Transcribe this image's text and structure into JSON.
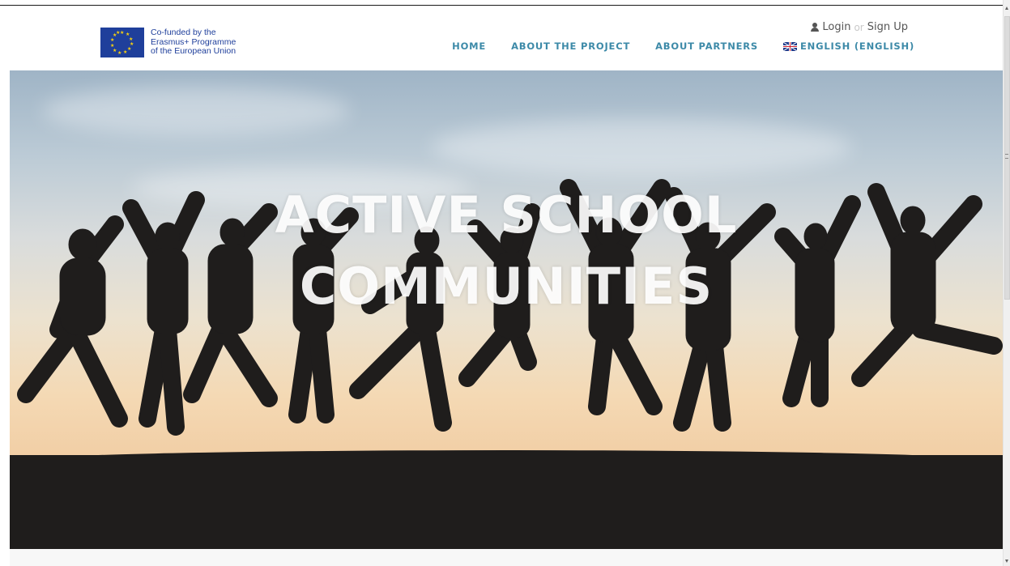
{
  "logo": {
    "line1": "Co-funded by the",
    "line2": "Erasmus+ Programme",
    "line3": "of the European Union",
    "icon": "eu-flag-icon"
  },
  "auth": {
    "login_label": "Login",
    "or_label": "or",
    "signup_label": "Sign Up",
    "icon": "user-icon"
  },
  "nav": {
    "items": [
      {
        "label": "HOME"
      },
      {
        "label": "ABOUT THE PROJECT"
      },
      {
        "label": "ABOUT PARTNERS"
      },
      {
        "label": "ENGLISH (ENGLISH)",
        "icon": "uk-flag-icon"
      }
    ]
  },
  "hero": {
    "title_line1": "ACTIVE SCHOOL",
    "title_line2": "COMMUNITIES"
  },
  "colors": {
    "nav_text": "#3d8aa8",
    "eu_blue": "#1f3f9b",
    "eu_star": "#f8d20f",
    "silhouette": "#1f1d1c"
  }
}
